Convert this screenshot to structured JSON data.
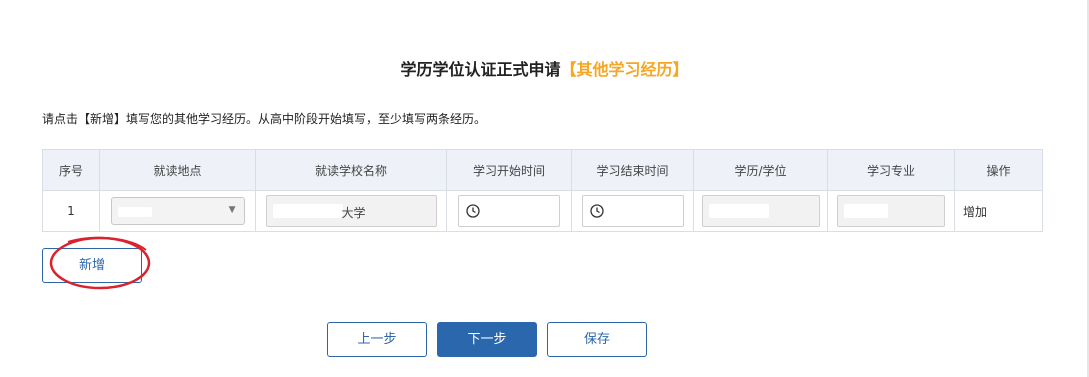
{
  "title": {
    "main": "学历学位认证正式申请",
    "accent": "【其他学习经历】"
  },
  "instruction": "请点击【新增】填写您的其他学习经历。从高中阶段开始填写，至少填写两条经历。",
  "table": {
    "headers": [
      "序号",
      "就读地点",
      "就读学校名称",
      "学习开始时间",
      "学习结束时间",
      "学历/学位",
      "学习专业",
      "操作"
    ],
    "rows": [
      {
        "index": "1",
        "school_visible": "大学",
        "action": "增加"
      }
    ]
  },
  "buttons": {
    "add": "新增",
    "prev": "上一步",
    "next": "下一步",
    "save": "保存"
  },
  "icons": {
    "select_arrow": "chevron-down-icon",
    "time": "clock-icon"
  },
  "colors": {
    "accent": "#f5a623",
    "primary": "#2a67ad",
    "annotation": "#d9232e"
  }
}
